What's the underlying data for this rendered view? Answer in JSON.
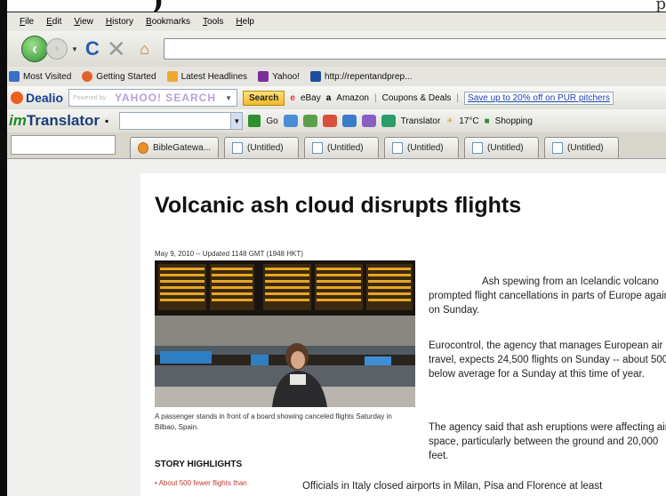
{
  "menu": [
    "File",
    "Edit",
    "View",
    "History",
    "Bookmarks",
    "Tools",
    "Help"
  ],
  "bookmarks": [
    "Most Visited",
    "Getting Started",
    "Latest Headlines",
    "Yahoo!",
    "http://repentandprep..."
  ],
  "dealio": {
    "logo": "Dealio",
    "search_prefix": "Powered by",
    "search_brand": "YAHOO! SEARCH",
    "search_button": "Search",
    "links": [
      "eBay",
      "Amazon",
      "Coupons & Deals"
    ],
    "promo": "Save up to 20% off on PUR pitchers"
  },
  "translator": {
    "logo_prefix": "im",
    "logo": "Translator",
    "go": "Go",
    "translator_menu": "Translator",
    "temperature": "17°C",
    "shopping": "Shopping"
  },
  "tabs": [
    "BibleGatewa...",
    "(Untitled)",
    "(Untitled)",
    "(Untitled)",
    "(Untitled)",
    "(Untitled)"
  ],
  "article": {
    "headline": "Volcanic ash cloud disrupts flights",
    "dateline": "May 9, 2010 -- Updated 1148 GMT (1948 HKT)",
    "caption": "A passenger stands in front of a board showing canceled flights Saturday in Bilbao, Spain.",
    "highlights_title": "STORY HIGHLIGHTS",
    "highlight_1": "• About 500 fewer flights than",
    "p1": "Ash spewing from an Icelandic volcano prompted flight cancellations in parts of Europe again on Sunday.",
    "p2": "Eurocontrol, the agency that manages European air travel, expects 24,500 flights on Sunday -- about 500 below average for a Sunday at this time of year.",
    "p3": "The agency said that ash eruptions were affecting air space, particularly between the ground and 20,000 feet.",
    "p4": "Officials in Italy closed airports in Milan, Pisa and Florence at least"
  }
}
